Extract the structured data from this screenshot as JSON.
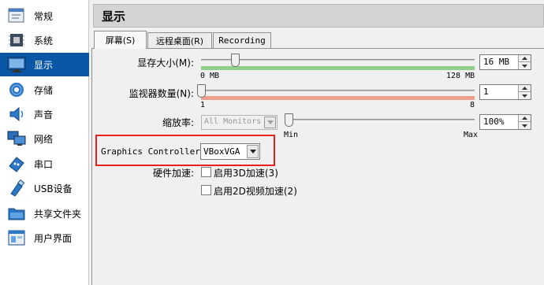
{
  "sidebar": {
    "items": [
      {
        "label": "常规",
        "icon": "general-icon"
      },
      {
        "label": "系统",
        "icon": "motherboard-icon"
      },
      {
        "label": "显示",
        "icon": "monitor-icon",
        "selected": true
      },
      {
        "label": "存储",
        "icon": "disk-icon"
      },
      {
        "label": "声音",
        "icon": "speaker-icon"
      },
      {
        "label": "网络",
        "icon": "network-icon"
      },
      {
        "label": "串口",
        "icon": "serial-port-icon"
      },
      {
        "label": "USB设备",
        "icon": "usb-icon"
      },
      {
        "label": "共享文件夹",
        "icon": "folder-icon"
      },
      {
        "label": "用户界面",
        "icon": "ui-window-icon"
      }
    ]
  },
  "header": {
    "title": "显示"
  },
  "tabs": [
    {
      "label": "屏幕(S)",
      "active": true
    },
    {
      "label": "远程桌面(R)",
      "active": false
    },
    {
      "label": "Recording",
      "active": false
    }
  ],
  "screen": {
    "video_memory": {
      "label": "显存大小(M):",
      "value": "16 MB",
      "min_label": "0 MB",
      "max_label": "128 MB",
      "level": 0.125
    },
    "monitor_count": {
      "label": "监视器数量(N):",
      "value": "1",
      "min_label": "1",
      "max_label": "8",
      "level": 0.0
    },
    "scale_factor": {
      "label": "缩放率:",
      "monitor_select": "All Monitors",
      "value": "100%",
      "min_label": "Min",
      "max_label": "Max",
      "level": 0.0
    },
    "graphics_controller": {
      "label": "Graphics Controller:",
      "value": "VBoxVGA"
    },
    "acceleration": {
      "label": "硬件加速:",
      "enable_3d": {
        "label": "启用3D加速(3)",
        "checked": false
      },
      "enable_2d": {
        "label": "启用2D视频加速(2)",
        "checked": false
      }
    }
  },
  "colors": {
    "selection": "#0a57a8",
    "memory_band_green": "#8fd18b",
    "memory_band_red": "#f0a08d",
    "monitor_band": "#f0a08d",
    "highlight_border": "#e6221f"
  }
}
